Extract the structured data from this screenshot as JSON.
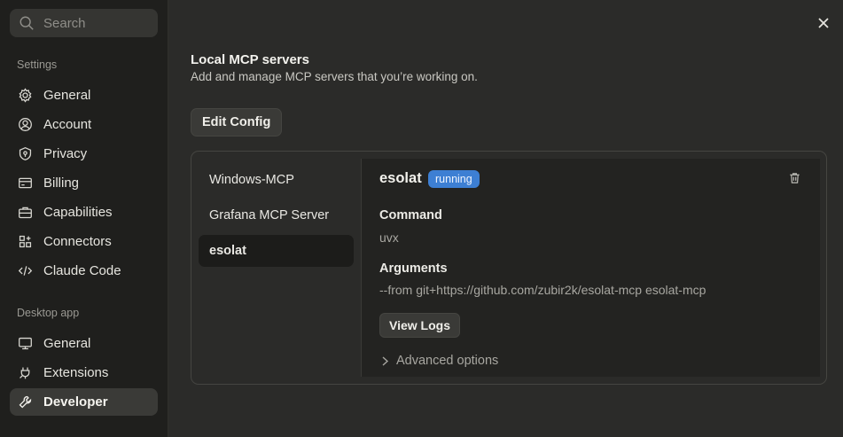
{
  "sidebar": {
    "search_placeholder": "Search",
    "settings_title": "Settings",
    "settings_items": [
      {
        "label": "General",
        "icon": "gear-icon"
      },
      {
        "label": "Account",
        "icon": "user-circle-icon"
      },
      {
        "label": "Privacy",
        "icon": "shield-icon"
      },
      {
        "label": "Billing",
        "icon": "credit-card-icon"
      },
      {
        "label": "Capabilities",
        "icon": "briefcase-icon"
      },
      {
        "label": "Connectors",
        "icon": "grid-plus-icon"
      },
      {
        "label": "Claude Code",
        "icon": "code-icon"
      }
    ],
    "desktop_title": "Desktop app",
    "desktop_items": [
      {
        "label": "General",
        "icon": "monitor-icon"
      },
      {
        "label": "Extensions",
        "icon": "plug-icon"
      },
      {
        "label": "Developer",
        "icon": "wrench-icon",
        "active": true
      }
    ]
  },
  "main": {
    "title": "Local MCP servers",
    "subtitle": "Add and manage MCP servers that you’re working on.",
    "edit_config_label": "Edit Config",
    "servers": [
      {
        "label": "Windows-MCP"
      },
      {
        "label": "Grafana MCP Server"
      },
      {
        "label": "esolat",
        "active": true
      }
    ],
    "detail": {
      "name": "esolat",
      "status": "running",
      "status_color": "#3d7fd3",
      "command_label": "Command",
      "command_value": "uvx",
      "arguments_label": "Arguments",
      "arguments_value": "--from git+https://github.com/zubir2k/esolat-mcp esolat-mcp",
      "view_logs_label": "View Logs",
      "advanced_label": "Advanced options"
    }
  }
}
